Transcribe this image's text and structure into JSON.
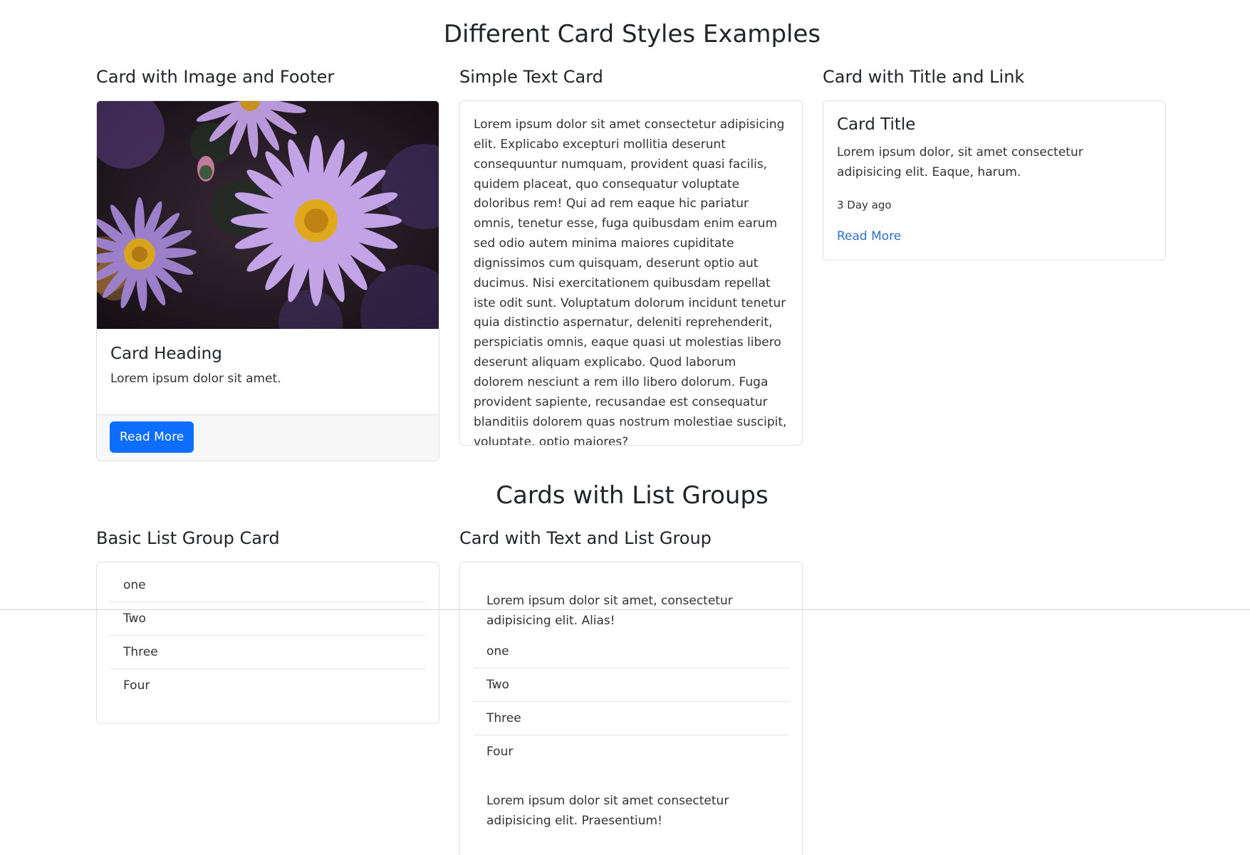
{
  "page": {
    "title": "Different Card Styles Examples",
    "section2_title": "Cards with List Groups"
  },
  "card_image_footer": {
    "heading": "Card with Image and Footer",
    "card_heading": "Card Heading",
    "text": "Lorem ipsum dolor sit amet.",
    "button_label": "Read More"
  },
  "simple_text_card": {
    "heading": "Simple Text Card",
    "text": "Lorem ipsum dolor sit amet consectetur adipisicing elit. Explicabo excepturi mollitia deserunt consequuntur numquam, provident quasi facilis, quidem placeat, quo consequatur voluptate doloribus rem! Qui ad rem eaque hic pariatur omnis, tenetur esse, fuga quibusdam enim earum sed odio autem minima maiores cupiditate dignissimos cum quisquam, deserunt optio aut ducimus. Nisi exercitationem quibusdam repellat iste odit sunt. Voluptatum dolorum incidunt tenetur quia distinctio aspernatur, deleniti reprehenderit, perspiciatis omnis, eaque quasi ut molestias libero deserunt aliquam explicabo. Quod laborum dolorem nesciunt a rem illo libero dolorum. Fuga provident sapiente, recusandae est consequatur blanditiis dolorem quas nostrum molestiae suscipit, voluptate, optio maiores?"
  },
  "title_link_card": {
    "heading": "Card with Title and Link",
    "title": "Card Title",
    "text": "Lorem ipsum dolor, sit amet consectetur adipisicing elit. Eaque, harum.",
    "timestamp": "3 Day ago",
    "link_label": "Read More",
    "link_color": "#2f6fc4"
  },
  "basic_list_card": {
    "heading": "Basic List Group Card",
    "items": [
      "one",
      "Two",
      "Three",
      "Four"
    ]
  },
  "text_list_card": {
    "heading": "Card with Text and List Group",
    "top_text": "Lorem ipsum dolor sit amet, consectetur adipisicing elit. Alias!",
    "items": [
      "one",
      "Two",
      "Three",
      "Four"
    ],
    "bottom_text": "Lorem ipsum dolor sit amet consectetur adipisicing elit. Praesentium!"
  },
  "colors": {
    "primary": "#0d6efd",
    "text": "#212529",
    "border": "#dee2e6",
    "footer_bg": "#f7f7f7"
  }
}
